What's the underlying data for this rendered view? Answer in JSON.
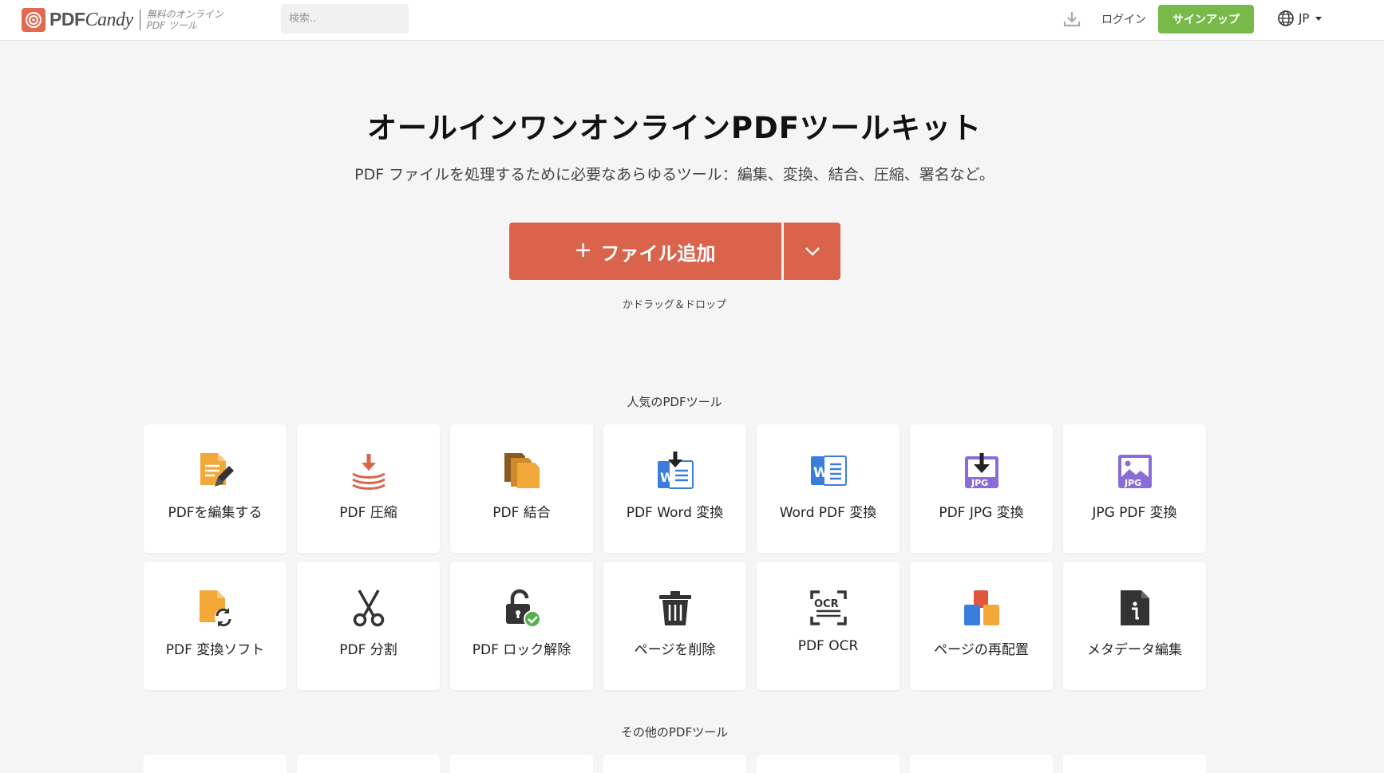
{
  "header": {
    "brand_word": "PDF",
    "brand_script": "Candy",
    "tagline_line1": "無料のオンライン",
    "tagline_line2": "PDF ツール",
    "search_placeholder": "検索..",
    "login_label": "ログイン",
    "signup_label": "サインアップ",
    "lang_code": "JP"
  },
  "hero": {
    "title": "オールインワンオンラインPDFツールキット",
    "subtitle": "PDF ファイルを処理するために必要なあらゆるツール：編集、変換、結合、圧縮、署名など。",
    "add_button_label": "ファイル追加",
    "drop_hint": "かドラッグ＆ドロップ"
  },
  "popular": {
    "heading": "人気のPDFツール",
    "tools": [
      {
        "label": "PDFを編集する",
        "icon": "edit-pdf-icon"
      },
      {
        "label": "PDF 圧縮",
        "icon": "compress-icon"
      },
      {
        "label": "PDF 結合",
        "icon": "merge-icon"
      },
      {
        "label": "PDF Word 変換",
        "icon": "pdf-to-word-icon"
      },
      {
        "label": "Word PDF 変換",
        "icon": "word-icon"
      },
      {
        "label": "PDF JPG 変換",
        "icon": "pdf-to-jpg-icon"
      },
      {
        "label": "JPG PDF 変換",
        "icon": "jpg-icon"
      },
      {
        "label": "PDF 変換ソフト",
        "icon": "convert-icon"
      },
      {
        "label": "PDF 分割",
        "icon": "scissors-icon"
      },
      {
        "label": "PDF ロック解除",
        "icon": "unlock-icon"
      },
      {
        "label": "ページを削除",
        "icon": "trash-icon"
      },
      {
        "label": "PDF OCR",
        "icon": "ocr-icon"
      },
      {
        "label": "ページの再配置",
        "icon": "rearrange-icon"
      },
      {
        "label": "メタデータ編集",
        "icon": "metadata-icon"
      }
    ]
  },
  "other": {
    "heading": "その他のPDFツール"
  },
  "colors": {
    "accent": "#d9634b",
    "signup": "#78b94a",
    "background": "#f5f5f5"
  }
}
